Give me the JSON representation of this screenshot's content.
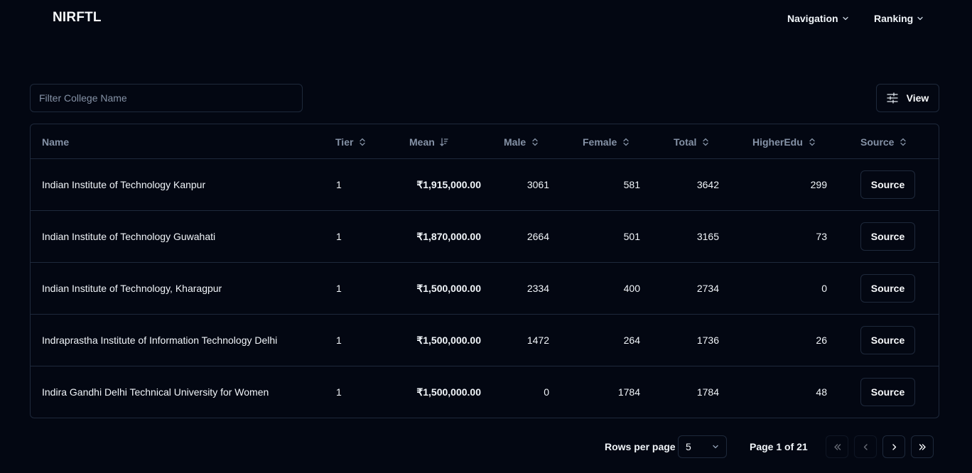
{
  "header": {
    "brand": "NIRFTL",
    "nav": [
      {
        "label": "Navigation",
        "icon": "chevron-down-icon"
      },
      {
        "label": "Ranking",
        "icon": "chevron-down-icon"
      }
    ]
  },
  "toolbar": {
    "filter_placeholder": "Filter College Name",
    "filter_value": "",
    "view_label": "View",
    "view_icon": "sliders-icon"
  },
  "table": {
    "columns": [
      {
        "key": "name",
        "label": "Name",
        "sort_icon": ""
      },
      {
        "key": "tier",
        "label": "Tier",
        "sort_icon": "sort-updown-icon"
      },
      {
        "key": "mean",
        "label": "Mean",
        "sort_icon": "sort-desc-icon"
      },
      {
        "key": "male",
        "label": "Male",
        "sort_icon": "sort-updown-icon"
      },
      {
        "key": "female",
        "label": "Female",
        "sort_icon": "sort-updown-icon"
      },
      {
        "key": "total",
        "label": "Total",
        "sort_icon": "sort-updown-icon"
      },
      {
        "key": "higheredu",
        "label": "HigherEdu",
        "sort_icon": "sort-updown-icon"
      },
      {
        "key": "source",
        "label": "Source",
        "sort_icon": "sort-updown-icon"
      }
    ],
    "rows": [
      {
        "name": "Indian Institute of Technology Kanpur",
        "tier": "1",
        "mean": "₹1,915,000.00",
        "male": "3061",
        "female": "581",
        "total": "3642",
        "higheredu": "299",
        "source": "Source"
      },
      {
        "name": "Indian Institute of Technology Guwahati",
        "tier": "1",
        "mean": "₹1,870,000.00",
        "male": "2664",
        "female": "501",
        "total": "3165",
        "higheredu": "73",
        "source": "Source"
      },
      {
        "name": "Indian Institute of Technology, Kharagpur",
        "tier": "1",
        "mean": "₹1,500,000.00",
        "male": "2334",
        "female": "400",
        "total": "2734",
        "higheredu": "0",
        "source": "Source"
      },
      {
        "name": "Indraprastha Institute of Information Technology Delhi",
        "tier": "1",
        "mean": "₹1,500,000.00",
        "male": "1472",
        "female": "264",
        "total": "1736",
        "higheredu": "26",
        "source": "Source"
      },
      {
        "name": "Indira Gandhi Delhi Technical University for Women",
        "tier": "1",
        "mean": "₹1,500,000.00",
        "male": "0",
        "female": "1784",
        "total": "1784",
        "higheredu": "48",
        "source": "Source"
      }
    ]
  },
  "pagination": {
    "rows_per_page_label": "Rows per page",
    "rows_per_page_value": "5",
    "page_info": "Page 1 of 21"
  },
  "colors": {
    "background": "#030712",
    "border": "#1e293b",
    "muted_text": "#8592a6",
    "text": "#f8fafc"
  }
}
